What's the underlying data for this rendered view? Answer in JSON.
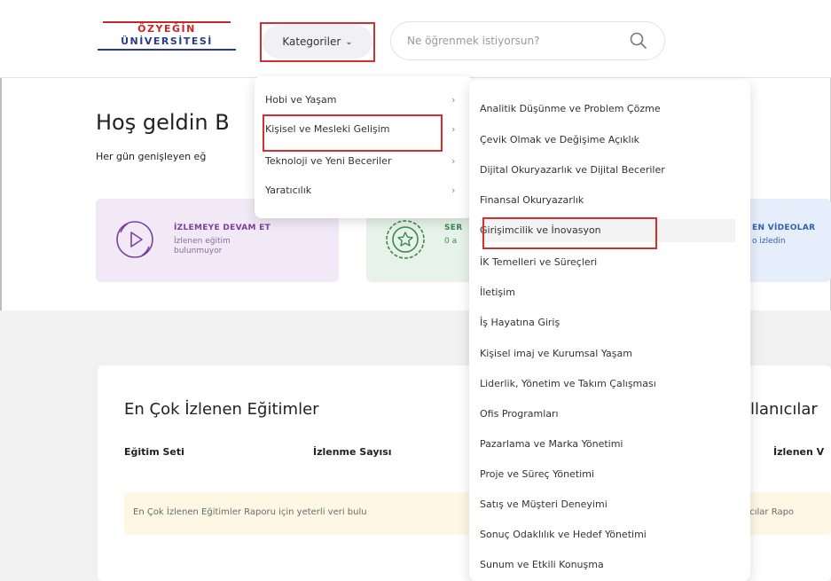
{
  "header": {
    "logo_line1": "ÖZYEĞİN",
    "logo_line2": "ÜNİVERSİTESİ",
    "categories_label": "Kategoriler",
    "search_placeholder": "Ne öğrenmek istiyorsun?"
  },
  "welcome": {
    "title": "Hoş geldin B",
    "subtitle": "Her gün genişleyen eğ"
  },
  "cards": [
    {
      "title": "İZLEMEYE DEVAM ET",
      "subtitle": "İzlenen eğitim bulunmuyor"
    },
    {
      "title": "SER",
      "subtitle": "0 a"
    },
    {
      "title": "EN VİDEOLAR",
      "subtitle": "o izledin"
    }
  ],
  "panel": {
    "title": "En Çok İzlenen Eğitimler",
    "title_right": "llanıcılar",
    "col1": "Eğitim Seti",
    "col2": "İzlenme Sayısı",
    "col3": "İzlenen V",
    "notice": "En Çok İzlenen Eğitimler Raporu için yeterli veri bulu",
    "notice_right": "anıcılar Rapo"
  },
  "menu_level1": [
    {
      "label": "Hobi ve Yaşam"
    },
    {
      "label": "Kişisel ve Mesleki Gelişim"
    },
    {
      "label": "Teknoloji ve Yeni Beceriler"
    },
    {
      "label": "Yaratıcılık"
    }
  ],
  "menu_level2": [
    {
      "label": "Analitik Düşünme ve Problem Çözme"
    },
    {
      "label": "Çevik Olmak ve Değişime Açıklık"
    },
    {
      "label": "Dijital Okuryazarlık ve Dijital Beceriler"
    },
    {
      "label": "Finansal Okuryazarlık"
    },
    {
      "label": "Girişimcilik ve İnovasyon"
    },
    {
      "label": "İK Temelleri ve Süreçleri"
    },
    {
      "label": "İletişim"
    },
    {
      "label": "İş Hayatına Giriş"
    },
    {
      "label": "Kişisel imaj ve Kurumsal Yaşam"
    },
    {
      "label": "Liderlik, Yönetim ve Takım Çalışması"
    },
    {
      "label": "Ofis Programları"
    },
    {
      "label": "Pazarlama ve Marka Yönetimi"
    },
    {
      "label": "Proje ve Süreç Yönetimi"
    },
    {
      "label": "Satış ve Müşteri Deneyimi"
    },
    {
      "label": "Sonuç Odaklılık ve Hedef Yönetimi"
    },
    {
      "label": "Sunum ve Etkili Konuşma"
    }
  ],
  "colors": {
    "highlight_border": "#d32f2f",
    "card_purple": "#f1eaf6",
    "card_green": "#e7f3ea",
    "card_blue": "#e6eefb",
    "notice_bg": "#fdf7e4"
  }
}
